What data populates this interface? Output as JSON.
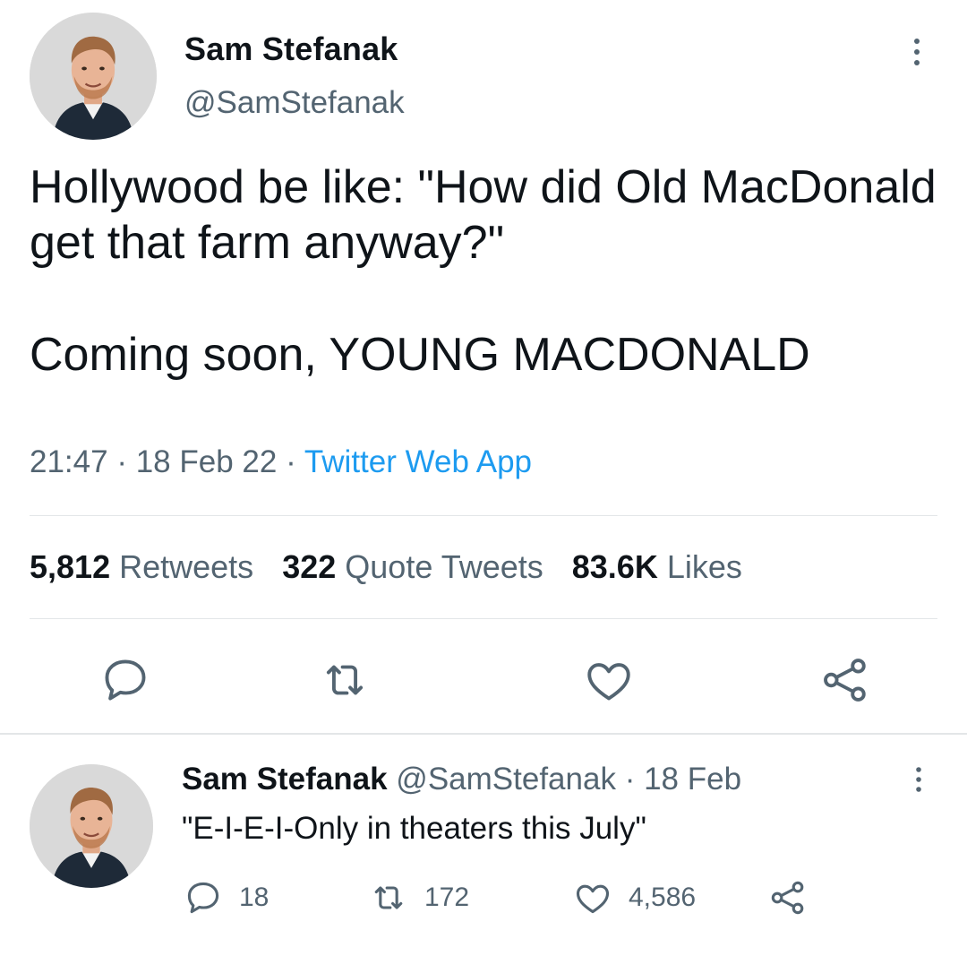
{
  "main_tweet": {
    "author_name": "Sam Stefanak",
    "author_handle": "@SamStefanak",
    "text_line1": "Hollywood be like: \"How did Old MacDonald get that farm anyway?\"",
    "text_line2": "Coming soon, YOUNG MACDONALD",
    "time": "21:47",
    "date": "18 Feb 22",
    "separator": "·",
    "source": "Twitter Web App",
    "stats": {
      "retweets_count": "5,812",
      "retweets_label": "Retweets",
      "quotes_count": "322",
      "quotes_label": "Quote Tweets",
      "likes_count": "83.6K",
      "likes_label": "Likes"
    },
    "actions": [
      "reply-icon",
      "retweet-icon",
      "like-icon",
      "share-icon"
    ]
  },
  "reply_tweet": {
    "author_name": "Sam Stefanak",
    "author_handle": "@SamStefanak",
    "separator": "·",
    "date": "18 Feb",
    "text": "\"E-I-E-I-Only in theaters this July\"",
    "replies": "18",
    "retweets": "172",
    "likes": "4,586"
  },
  "colors": {
    "text": "#0f1419",
    "secondary": "#536471",
    "link": "#1d9bf0",
    "divider": "#e3e6e8"
  }
}
